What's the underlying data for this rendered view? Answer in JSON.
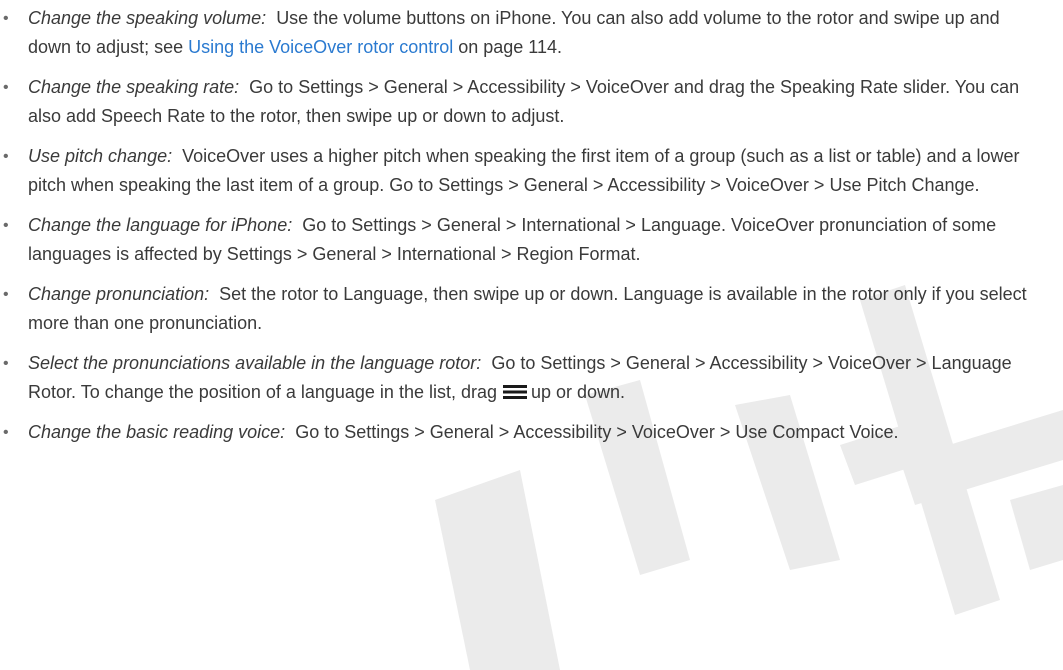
{
  "watermark": {
    "color": "#ebebeb"
  },
  "bullet_glyph": "•",
  "items": [
    {
      "term": "Change the speaking volume:",
      "body": "Use the volume buttons on iPhone. You can also add volume to the rotor and swipe up and down to adjust; see ",
      "link": "Using the VoiceOver rotor control",
      "after": " on page 114."
    },
    {
      "term": "Change the speaking rate:",
      "body": "Go to Settings > General > Accessibility > VoiceOver and drag the Speaking Rate slider. You can also add Speech Rate to the rotor, then swipe up or down to adjust."
    },
    {
      "term": "Use pitch change:",
      "body": "VoiceOver uses a higher pitch when speaking the first item of a group (such as a list or table) and a lower pitch when speaking the last item of a group. Go to Settings > General > Accessibility > VoiceOver > Use Pitch Change."
    },
    {
      "term": "Change the language for iPhone:",
      "body": "Go to Settings > General > International > Language. VoiceOver pronunciation of some languages is affected by Settings > General > International > Region Format."
    },
    {
      "term": "Change pronunciation:",
      "body": "Set the rotor to Language, then swipe up or down. Language is available in the rotor only if you select more than one pronunciation."
    },
    {
      "term": "Select the pronunciations available in the language rotor:",
      "body": "Go to Settings > General > Accessibility > VoiceOver > Language Rotor. To change the position of a language in the list, drag",
      "icon": "reorder-handle-icon",
      "after": "up or down."
    },
    {
      "term": "Change the basic reading voice:",
      "body": "Go to Settings > General > Accessibility > VoiceOver > Use Compact Voice."
    }
  ]
}
